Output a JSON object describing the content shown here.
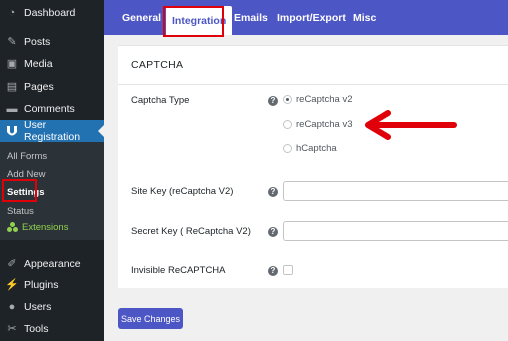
{
  "sidebar": {
    "items": [
      {
        "label": "Dashboard",
        "icon": "dashboard-icon"
      },
      {
        "label": "Posts",
        "icon": "pin-icon"
      },
      {
        "label": "Media",
        "icon": "media-icon"
      },
      {
        "label": "Pages",
        "icon": "pages-icon"
      },
      {
        "label": "Comments",
        "icon": "comment-icon"
      },
      {
        "label": "User Registration",
        "icon": "ur-logo-icon"
      },
      {
        "label": "Appearance",
        "icon": "brush-icon"
      },
      {
        "label": "Plugins",
        "icon": "plugin-icon"
      },
      {
        "label": "Users",
        "icon": "users-icon"
      },
      {
        "label": "Tools",
        "icon": "wrench-icon"
      }
    ],
    "submenu": {
      "all_forms": "All Forms",
      "add_new": "Add New",
      "settings": "Settings",
      "status": "Status",
      "extensions": "Extensions"
    }
  },
  "tabs": [
    "General",
    "Integration",
    "Emails",
    "Import/Export",
    "Misc"
  ],
  "active_tab": "Integration",
  "section": {
    "title": "CAPTCHA",
    "captcha_type_label": "Captcha Type",
    "captcha_options": [
      {
        "label": "reCaptcha v2",
        "checked": true
      },
      {
        "label": "reCaptcha v3",
        "checked": false
      },
      {
        "label": "hCaptcha",
        "checked": false
      }
    ],
    "site_key_label": "Site Key (reCaptcha V2)",
    "site_key_value": "",
    "secret_key_label": "Secret Key ( ReCaptcha V2)",
    "secret_key_value": "",
    "invisible_label": "Invisible ReCAPTCHA",
    "invisible_checked": false
  },
  "save_button": "Save Changes",
  "colors": {
    "sidebar_bg": "#1d2327",
    "tabbar_bg": "#4c56c5",
    "active_menu": "#2271b1",
    "extensions_green": "#8fd14f",
    "annotation_red": "#e0000a"
  }
}
